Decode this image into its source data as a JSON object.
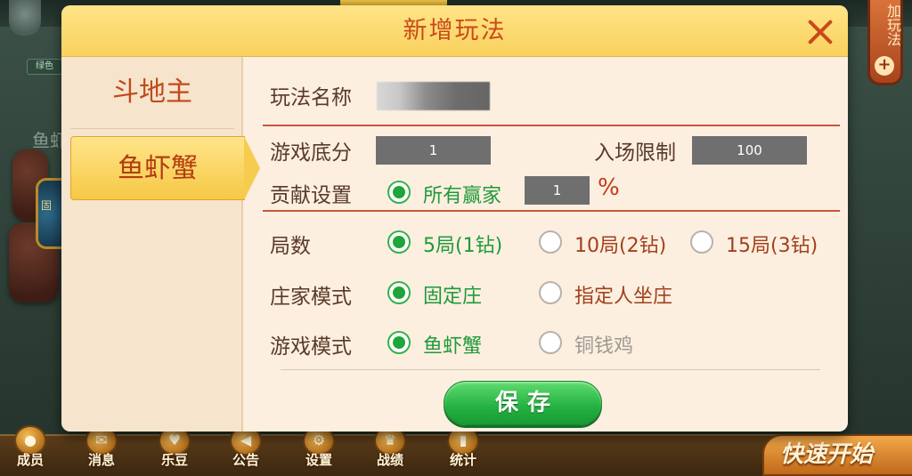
{
  "background": {
    "tag": "绿色",
    "card_label": "鱼虾",
    "table_text": "固",
    "add_play_label": "加玩法",
    "add_play_plus": "+",
    "bottom_nav": [
      {
        "label": "成员",
        "icon": "member-icon"
      },
      {
        "label": "消息",
        "icon": "message-icon"
      },
      {
        "label": "乐豆",
        "icon": "bean-icon"
      },
      {
        "label": "公告",
        "icon": "announcement-icon"
      },
      {
        "label": "设置",
        "icon": "gear-icon"
      },
      {
        "label": "战绩",
        "icon": "trophy-icon"
      },
      {
        "label": "统计",
        "icon": "stats-icon"
      }
    ],
    "quick_start": "快速开始"
  },
  "modal": {
    "title": "新增玩法",
    "close_icon": "close-icon",
    "sidebar": {
      "items": [
        {
          "label": "斗地主",
          "active": false
        },
        {
          "label": "鱼虾蟹",
          "active": true
        }
      ]
    },
    "form": {
      "name_label": "玩法名称",
      "name_value": "",
      "base_score_label": "游戏底分",
      "base_score_value": "1",
      "entry_limit_label": "入场限制",
      "entry_limit_value": "100",
      "contribution_label": "贡献设置",
      "contribution_option": "所有赢家",
      "contribution_value": "1",
      "contribution_unit": "%",
      "rounds_label": "局数",
      "rounds_options": [
        "5局(1钻)",
        "10局(2钻)",
        "15局(3钻)"
      ],
      "rounds_selected": 0,
      "banker_label": "庄家模式",
      "banker_options": [
        "固定庄",
        "指定人坐庄"
      ],
      "banker_selected": 0,
      "game_mode_label": "游戏模式",
      "game_mode_options": [
        "鱼虾蟹",
        "铜钱鸡"
      ],
      "game_mode_selected": 0
    },
    "save_label": "保存"
  },
  "colors": {
    "header": "#f9d15e",
    "title": "#c94a1b",
    "selected_green": "#1fa53a",
    "save_green": "#23b141",
    "divider_red": "#c9563a"
  }
}
